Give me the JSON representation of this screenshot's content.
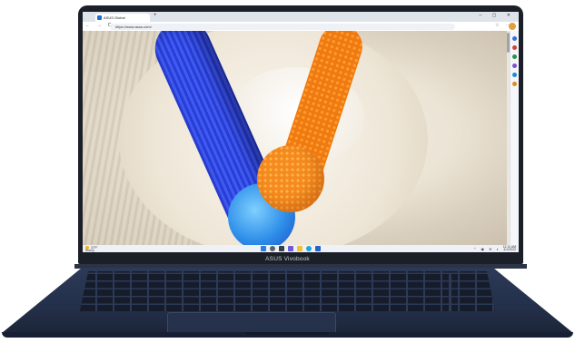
{
  "browser": {
    "tab_title": "ASUS Global",
    "new_tab": "+",
    "window_controls": "– ▢ ✕",
    "nav_buttons": "← → C ⌂",
    "url": "https://www.asus.com/"
  },
  "taskbar": {
    "weather_temp": "22°F",
    "weather_desc": "Sunny",
    "tray_time": "11:11 AM",
    "tray_date": "4/1/2022"
  },
  "device": {
    "brand_text": "ASUS Vivobook"
  },
  "colors": {
    "chassis": "#24304a",
    "accent_blue": "#3f5cf2",
    "accent_orange": "#f58a1f"
  },
  "icons": [
    "search-icon",
    "windows-start-icon",
    "task-view-icon",
    "folder-icon",
    "edge-icon",
    "store-icon"
  ]
}
